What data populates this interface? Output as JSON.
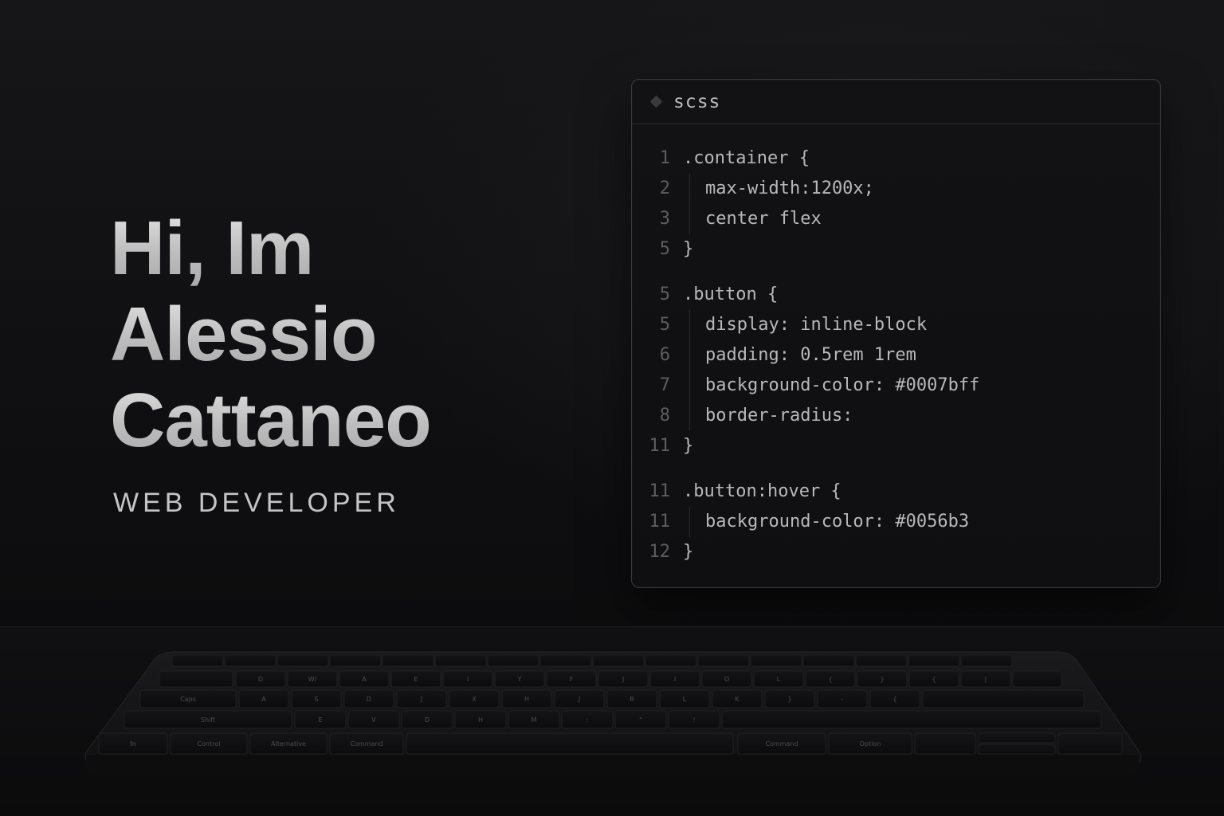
{
  "hero": {
    "line1": "Hi, Im",
    "line2": "Alessio",
    "line3": "Cattaneo",
    "subtitle": "WEB DEVELOPER"
  },
  "code_window": {
    "language_icon": "diamond-icon",
    "language": "scss",
    "lines": [
      {
        "num": "1",
        "text": ".container {",
        "indent": false,
        "gap": false
      },
      {
        "num": "2",
        "text": "max-width:1200x;",
        "indent": true,
        "gap": false
      },
      {
        "num": "3",
        "text": "center flex",
        "indent": true,
        "gap": false
      },
      {
        "num": "5",
        "text": "}",
        "indent": false,
        "gap": false
      },
      {
        "num": "5",
        "text": ".button {",
        "indent": false,
        "gap": true
      },
      {
        "num": "5",
        "text": "display: inline-block",
        "indent": true,
        "gap": false
      },
      {
        "num": "6",
        "text": "padding: 0.5rem 1rem",
        "indent": true,
        "gap": false
      },
      {
        "num": "7",
        "text": "background-color: #0007bff",
        "indent": true,
        "gap": false
      },
      {
        "num": "8",
        "text": "border-radius:",
        "indent": true,
        "gap": false
      },
      {
        "num": "11",
        "text": "}",
        "indent": false,
        "gap": false
      },
      {
        "num": "11",
        "text": ".button:hover {",
        "indent": false,
        "gap": true
      },
      {
        "num": "11",
        "text": "background-color: #0056b3",
        "indent": true,
        "gap": false
      },
      {
        "num": "12",
        "text": "}",
        "indent": false,
        "gap": false
      }
    ]
  },
  "keyboard": {
    "icon": "keyboard-icon",
    "row1_legends": [
      "D",
      "W/",
      "A",
      "E",
      "I",
      "Y",
      "F",
      "J",
      "I",
      "O",
      "L",
      "{",
      "}",
      "{",
      "|"
    ],
    "row2_legends": [
      "A",
      "S",
      "D",
      "J",
      "X",
      "H",
      "J",
      "B",
      "L",
      "K",
      "}",
      "-",
      "{"
    ],
    "row3_legends": [
      "E",
      "V",
      "D",
      "H",
      "M",
      ":",
      "\"",
      "!"
    ],
    "left_labels": [
      "Caps",
      "Shift",
      "Alt"
    ],
    "bottom_labels": [
      "fn",
      "Control",
      "Alternative",
      "Command",
      "Command",
      "Option"
    ]
  },
  "colors": {
    "background": "#0e0e10",
    "hero_text": "#cfcfcf",
    "code_text": "#b8b8b8",
    "line_number": "#5d5d60",
    "border": "#3a3a3d"
  }
}
